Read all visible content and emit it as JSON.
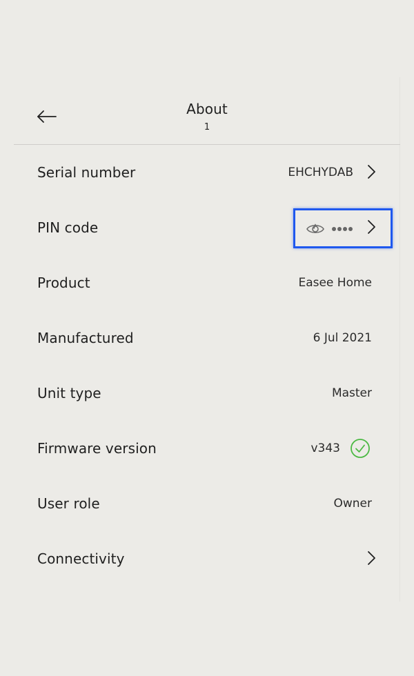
{
  "header": {
    "title": "About",
    "subtitle": "1",
    "back_icon": "back-arrow-icon"
  },
  "rows": [
    {
      "label": "Serial number",
      "value": "EHCHYDAB",
      "has_chevron": true
    },
    {
      "label": "PIN code",
      "value": "••••",
      "has_chevron": true,
      "icon": "eye-icon",
      "highlighted": true
    },
    {
      "label": "Product",
      "value": "Easee Home"
    },
    {
      "label": "Manufactured",
      "value": "6 Jul 2021"
    },
    {
      "label": "Unit type",
      "value": "Master"
    },
    {
      "label": "Firmware version",
      "value": "v343",
      "status_icon": "check-circle-icon"
    },
    {
      "label": "User role",
      "value": "Owner"
    },
    {
      "label": "Connectivity",
      "value": "",
      "has_chevron": true
    }
  ],
  "colors": {
    "background": "#ecebe7",
    "highlight_border": "#1f58ee",
    "success": "#4cb944",
    "text": "#1f1f1f"
  }
}
